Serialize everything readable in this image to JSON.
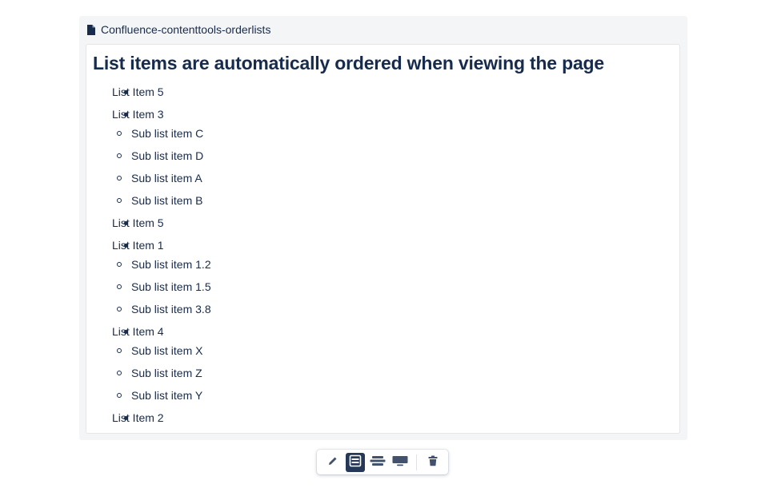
{
  "macro": {
    "title": "Confluence-contenttools-orderlists",
    "icon": "file-icon"
  },
  "content": {
    "heading": "List items are automatically ordered when viewing the page",
    "items": [
      {
        "label": "List Item 5",
        "children": []
      },
      {
        "label": "List Item 3",
        "children": [
          "Sub list item C",
          "Sub list item D",
          "Sub list item A",
          "Sub list item B"
        ]
      },
      {
        "label": "List Item 5",
        "children": []
      },
      {
        "label": "List Item 1",
        "children": [
          "Sub list item 1.2",
          "Sub list item 1.5",
          "Sub list item 3.8"
        ]
      },
      {
        "label": "List Item 4",
        "children": [
          "Sub list item X",
          "Sub list item Z",
          "Sub list item Y"
        ]
      },
      {
        "label": "List Item 2",
        "children": []
      }
    ]
  },
  "toolbar": {
    "buttons": [
      {
        "name": "edit-button",
        "icon": "pencil-icon",
        "active": false
      },
      {
        "name": "layout-default-button",
        "icon": "layout-center-icon",
        "active": true
      },
      {
        "name": "layout-wide-button",
        "icon": "layout-wide-icon",
        "active": false
      },
      {
        "name": "layout-full-width-button",
        "icon": "layout-full-width-icon",
        "active": false
      },
      {
        "name": "delete-button",
        "icon": "trash-icon",
        "active": false
      }
    ]
  },
  "colors": {
    "text": "#172b4d",
    "macro_bg": "#f4f5f7",
    "active_button": "#253858",
    "icon": "#42526e"
  }
}
